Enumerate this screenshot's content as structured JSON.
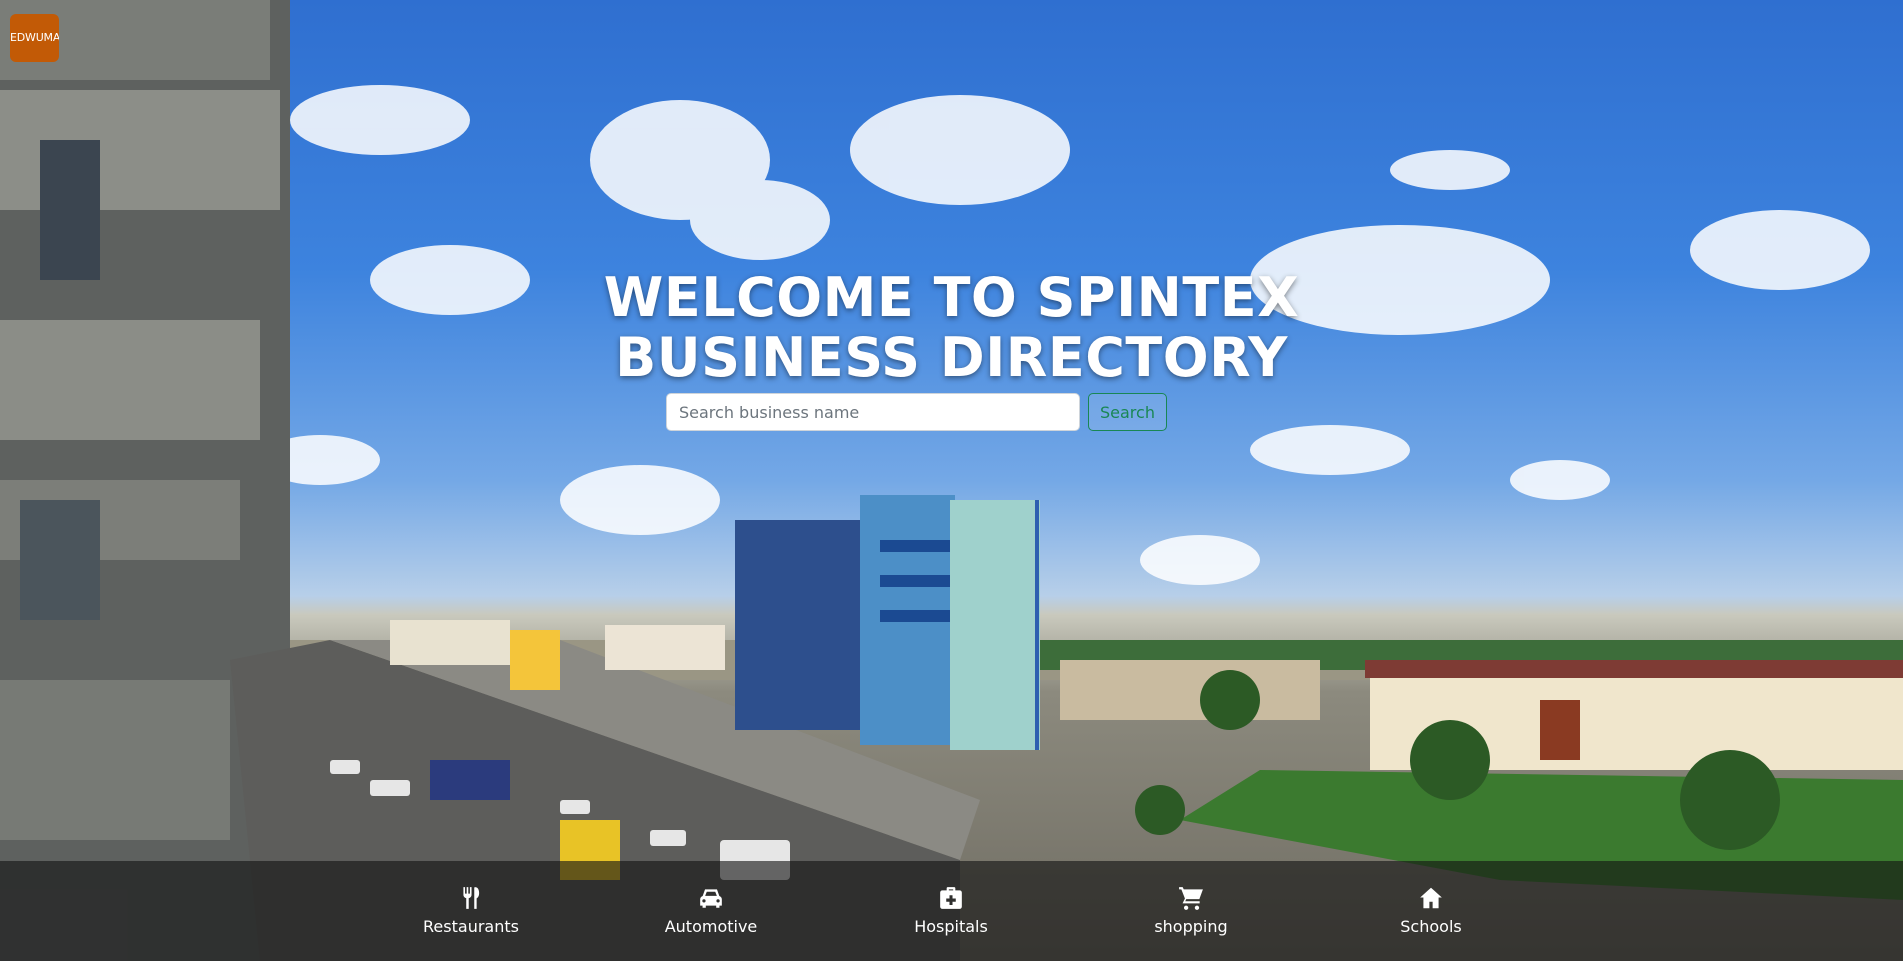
{
  "brand": {
    "logo_text": "EDWUMA"
  },
  "hero": {
    "title_line1": "WELCOME TO SPINTEX",
    "title_line2": "BUSINESS DIRECTORY"
  },
  "search": {
    "placeholder": "Search business name",
    "value": "",
    "button_label": "Search"
  },
  "nav": {
    "items": [
      {
        "label": "Restaurants",
        "icon": "utensils-icon"
      },
      {
        "label": "Automotive",
        "icon": "car-icon"
      },
      {
        "label": "Hospitals",
        "icon": "medical-kit-icon"
      },
      {
        "label": "shopping",
        "icon": "shopping-cart-icon"
      },
      {
        "label": "Schools",
        "icon": "home-icon"
      }
    ]
  },
  "colors": {
    "logo_bg": "#c25a06",
    "search_button": "#198754",
    "nav_bg": "rgba(20,20,20,0.62)"
  }
}
